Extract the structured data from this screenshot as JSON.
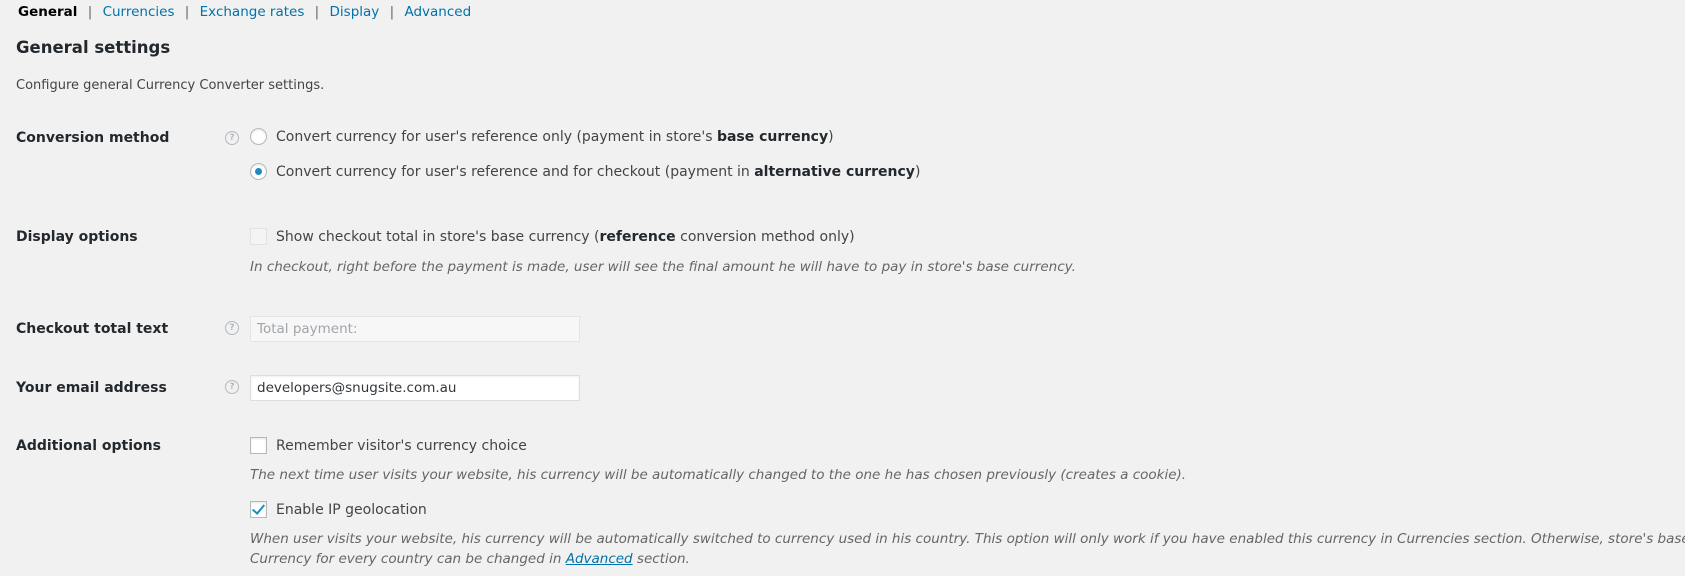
{
  "subnav": {
    "items": [
      {
        "label": "General",
        "current": true
      },
      {
        "label": "Currencies",
        "current": false
      },
      {
        "label": "Exchange rates",
        "current": false
      },
      {
        "label": "Display",
        "current": false
      },
      {
        "label": "Advanced",
        "current": false
      }
    ],
    "separator": "|"
  },
  "page": {
    "title": "General settings",
    "intro": "Configure general Currency Converter settings."
  },
  "icons": {
    "help": "?"
  },
  "conversion_method": {
    "label": "Conversion method",
    "options": [
      {
        "text_before": "Convert currency for user's reference only (payment in store's ",
        "bold": "base currency",
        "text_after": ")",
        "checked": false
      },
      {
        "text_before": "Convert currency for user's reference and for checkout (payment in ",
        "bold": "alternative currency",
        "text_after": ")",
        "checked": true
      }
    ]
  },
  "display_options": {
    "label": "Display options",
    "checkbox": {
      "text_before": "Show checkout total in store's base currency (",
      "bold": "reference",
      "text_after": " conversion method only)",
      "checked": false,
      "disabled": true
    },
    "description": "In checkout, right before the payment is made, user will see the final amount he will have to pay in store's base currency."
  },
  "checkout_total_text": {
    "label": "Checkout total text",
    "value": "",
    "placeholder": "Total payment:",
    "disabled": true
  },
  "email": {
    "label": "Your email address",
    "value": "developers@snugsite.com.au"
  },
  "additional_options": {
    "label": "Additional options",
    "remember_choice": {
      "label": "Remember visitor's currency choice",
      "checked": false,
      "description": "The next time user visits your website, his currency will be automatically changed to the one he has chosen previously (creates a cookie)."
    },
    "ip_geolocation": {
      "label": "Enable IP geolocation",
      "checked": true,
      "description_line1": "When user visits your website, his currency will be automatically switched to currency used in his country. This option will only work if you have enabled this currency in Currencies section. Otherwise, store's base currency will be used.",
      "description_line2_before": "Currency for every country can be changed in ",
      "description_line2_link": "Advanced",
      "description_line2_after": " section."
    }
  },
  "colors": {
    "background": "#f1f1f1",
    "link": "#0073aa",
    "accent": "#1e8cbe",
    "heading": "#23282d",
    "description": "#666666"
  }
}
